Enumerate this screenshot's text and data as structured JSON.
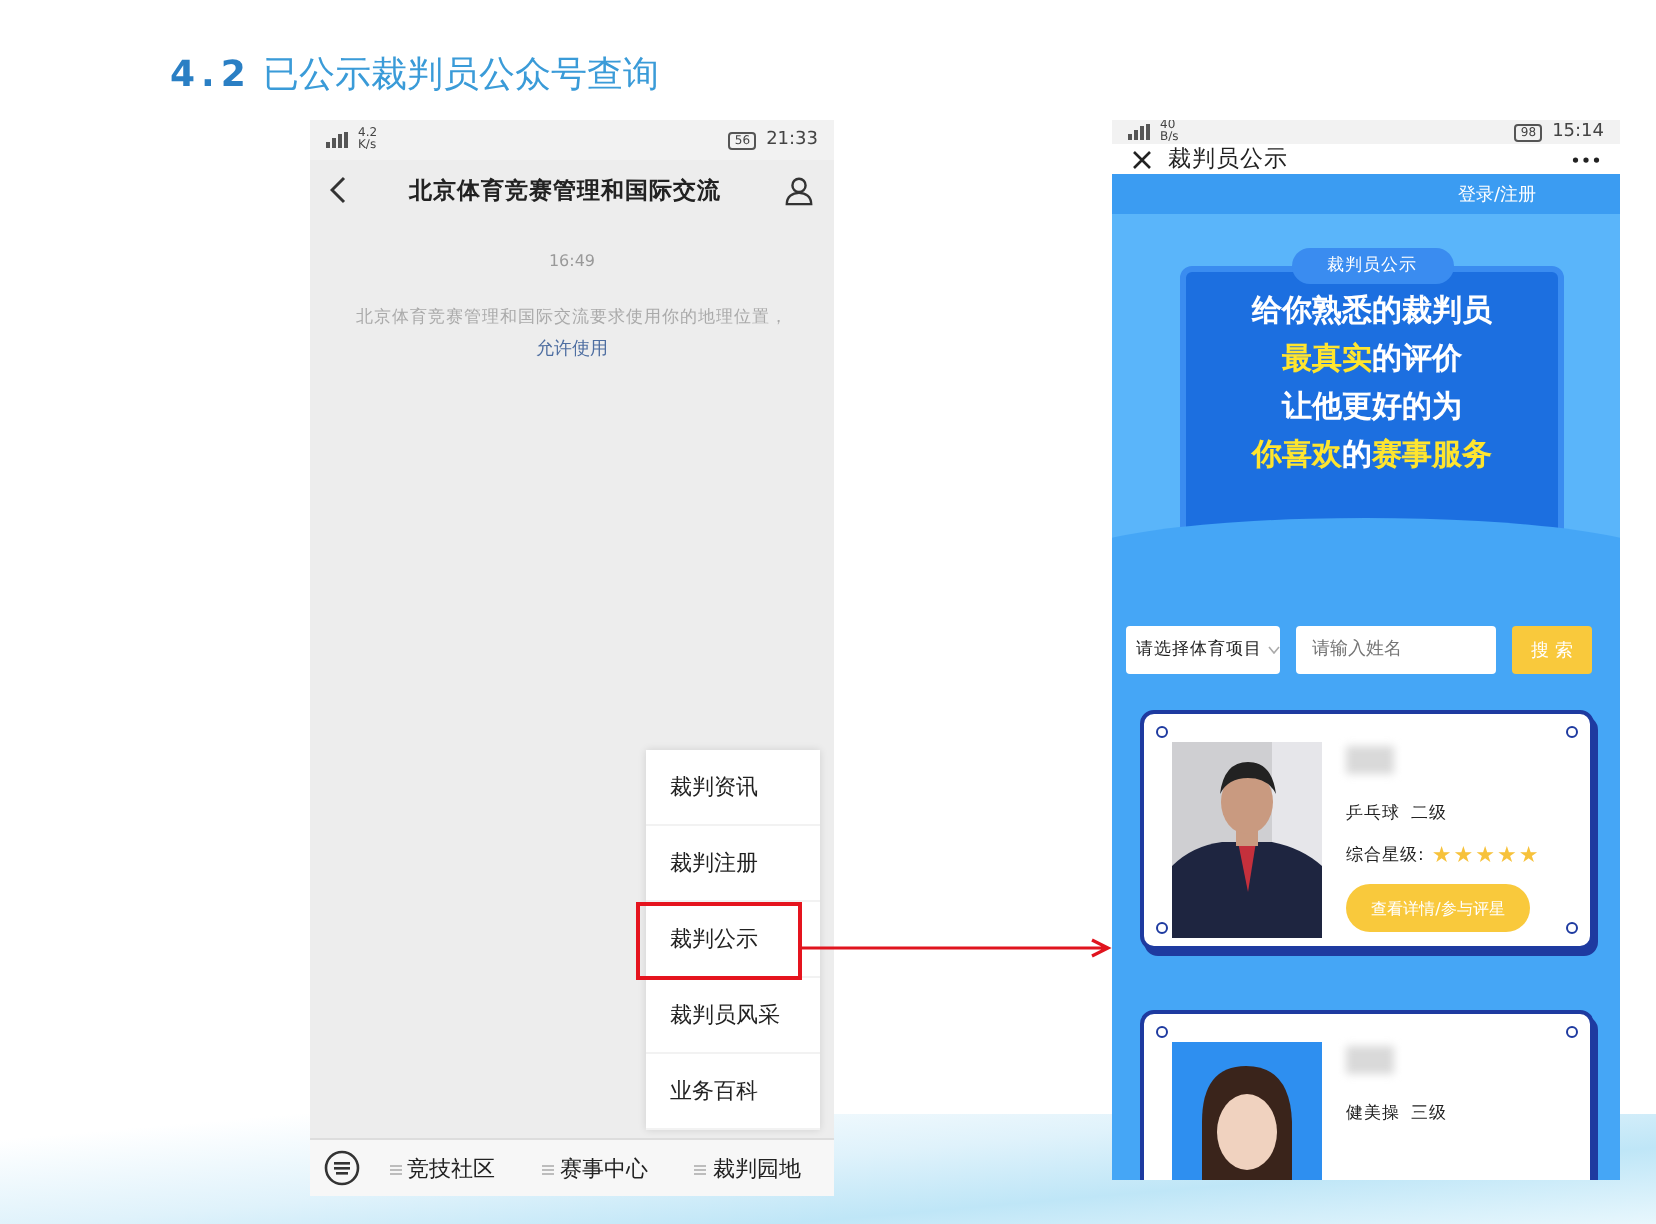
{
  "title": {
    "number": "4.2",
    "text": "已公示裁判员公众号查询"
  },
  "left_phone": {
    "status_bar": {
      "speed": "4.2",
      "speed_unit": "K/s",
      "battery": "56",
      "time": "21:33"
    },
    "nav_title": "北京体育竞赛管理和国际交流",
    "chat_time": "16:49",
    "message": "北京体育竞赛管理和国际交流要求使用你的地理位置，",
    "message_link": "允许使用",
    "menu": [
      {
        "label": "裁判资讯",
        "selected": false
      },
      {
        "label": "裁判注册",
        "selected": false
      },
      {
        "label": "裁判公示",
        "selected": true
      },
      {
        "label": "裁判员风采",
        "selected": false
      },
      {
        "label": "业务百科",
        "selected": false
      }
    ],
    "bottom_tabs": [
      "竞技社区",
      "赛事中心",
      "裁判园地"
    ]
  },
  "right_phone": {
    "status_bar": {
      "speed": "40",
      "speed_unit": "B/s",
      "battery": "98",
      "time": "15:14"
    },
    "page_title": "裁判员公示",
    "login": "登录/注册",
    "banner": {
      "tag": "裁判员公示",
      "lines": [
        [
          {
            "text": "给你熟悉的裁判员",
            "highlight": false
          }
        ],
        [
          {
            "text": "最真实",
            "highlight": true
          },
          {
            "text": "的评价",
            "highlight": false
          }
        ],
        [
          {
            "text": "让他更好的为",
            "highlight": false
          }
        ],
        [
          {
            "text": "你喜欢",
            "highlight": true
          },
          {
            "text": "的",
            "highlight": false
          },
          {
            "text": "赛事服务",
            "highlight": true
          }
        ]
      ]
    },
    "search": {
      "select": "请选择体育项目",
      "placeholder": "请输入姓名",
      "button": "搜 索"
    },
    "cards": [
      {
        "sport": "乒乓球",
        "level": "二级",
        "rating_label": "综合星级:",
        "stars": 5,
        "button": "查看详情/参与评星"
      },
      {
        "sport": "健美操",
        "level": "三级"
      }
    ]
  }
}
